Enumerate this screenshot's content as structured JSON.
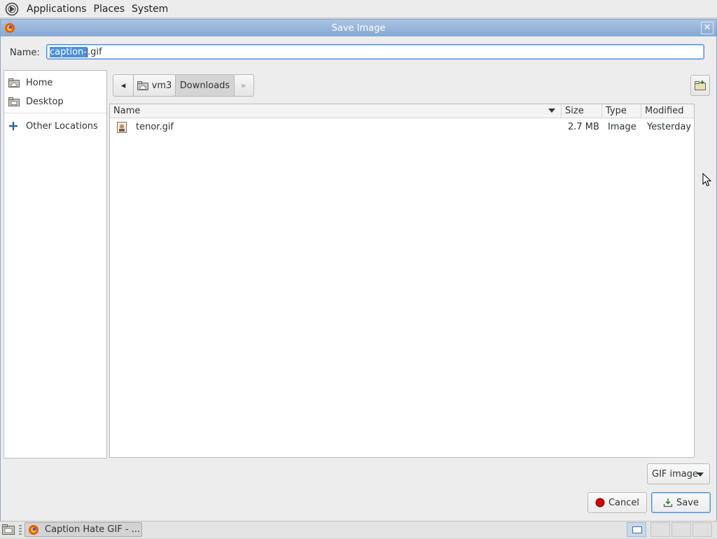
{
  "top_panel": {
    "menus": [
      "Applications",
      "Places",
      "System"
    ]
  },
  "dialog": {
    "title": "Save Image",
    "close_glyph": "✕",
    "name_label": "Name:",
    "name_value_selected": "caption-",
    "name_value_rest": ".gif"
  },
  "sidebar": {
    "items": [
      {
        "label": "Home",
        "icon": "home-folder-icon"
      },
      {
        "label": "Desktop",
        "icon": "desktop-folder-icon"
      },
      {
        "label": "Other Locations",
        "icon": "plus-icon"
      }
    ]
  },
  "pathbar": {
    "segments": [
      "vm3",
      "Downloads"
    ],
    "back_glyph": "◂",
    "forward_glyph": "▸"
  },
  "filelist": {
    "columns": [
      "Name",
      "Size",
      "Type",
      "Modified"
    ],
    "rows": [
      {
        "name": "tenor.gif",
        "size": "2.7 MB",
        "type": "Image",
        "modified": "Yesterday"
      }
    ]
  },
  "filter": {
    "selected": "GIF image"
  },
  "buttons": {
    "cancel": "Cancel",
    "save": "Save"
  },
  "taskbar": {
    "task_label": "Caption Hate GIF - ..."
  },
  "colors": {
    "accent": "#4a90d9",
    "titlebar": "#86a8d4"
  }
}
